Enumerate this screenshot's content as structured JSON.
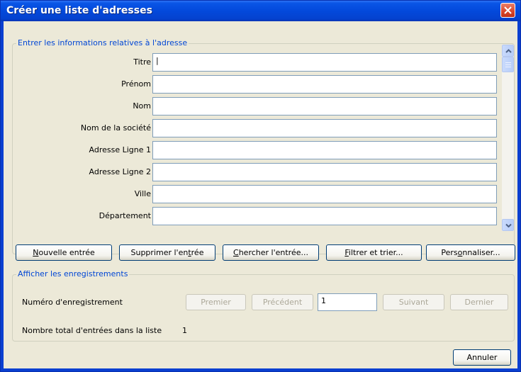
{
  "window": {
    "title": "Créer une liste d'adresses"
  },
  "entry_group": {
    "legend": "Entrer les informations relatives à l'adresse",
    "fields": [
      {
        "label": "Titre",
        "value": "|"
      },
      {
        "label": "Prénom",
        "value": ""
      },
      {
        "label": "Nom",
        "value": ""
      },
      {
        "label": "Nom de la société",
        "value": ""
      },
      {
        "label": "Adresse Ligne 1",
        "value": ""
      },
      {
        "label": "Adresse Ligne 2",
        "value": ""
      },
      {
        "label": "Ville",
        "value": ""
      },
      {
        "label": "Département",
        "value": ""
      }
    ]
  },
  "actions": {
    "new_entry": {
      "pre": "",
      "key": "N",
      "post": "ouvelle entrée"
    },
    "delete_entry": {
      "pre": "Supprimer l'en",
      "key": "t",
      "post": "rée"
    },
    "find_entry": {
      "pre": "",
      "key": "C",
      "post": "hercher l'entrée..."
    },
    "filter_sort": {
      "pre": "",
      "key": "F",
      "post": "iltrer et trier..."
    },
    "customize": {
      "pre": "Pers",
      "key": "o",
      "post": "nnaliser..."
    }
  },
  "records_group": {
    "legend": "Afficher les enregistrements",
    "record_label": {
      "pre": "Numéro d'enre",
      "key": "g",
      "post": "istrement"
    },
    "first_label": "Premier",
    "previous_label": "Précédent",
    "record_value": "1",
    "next_label": "Suivant",
    "last_label": "Dernier",
    "total_label": "Nombre total d'entrées dans la liste",
    "total_value": "1"
  },
  "footer": {
    "cancel_label": "Annuler"
  }
}
